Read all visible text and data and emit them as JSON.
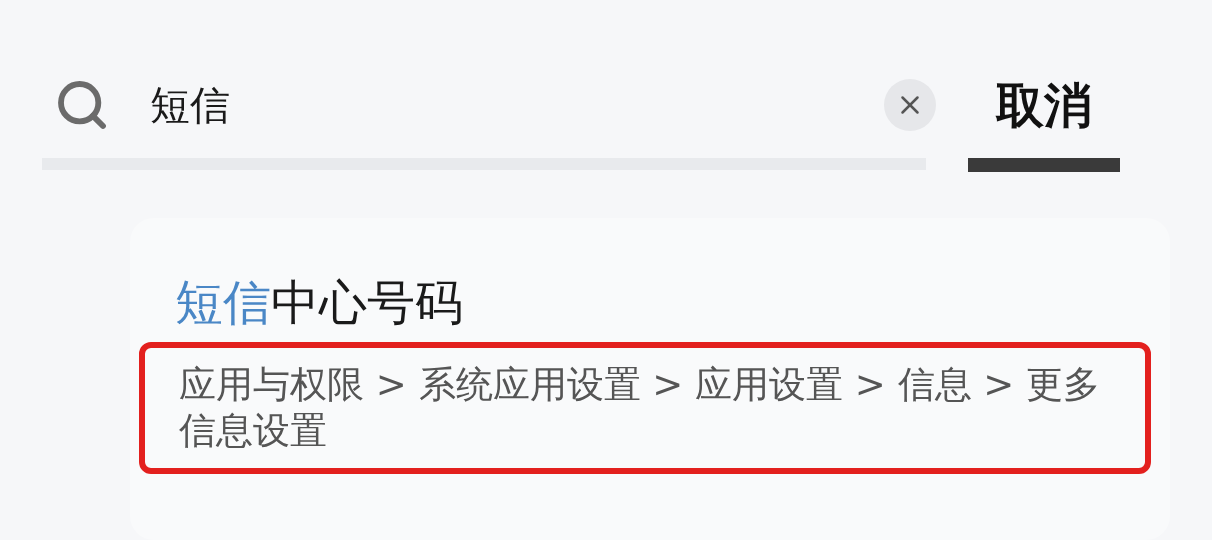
{
  "search": {
    "query": "短信",
    "cancel": "取消"
  },
  "result": {
    "title_match": "短信",
    "title_rest": "中心号码",
    "path": "应用与权限 > 系统应用设置 > 应用设置 > 信息 > 更多信息设置",
    "highlighted": true
  }
}
